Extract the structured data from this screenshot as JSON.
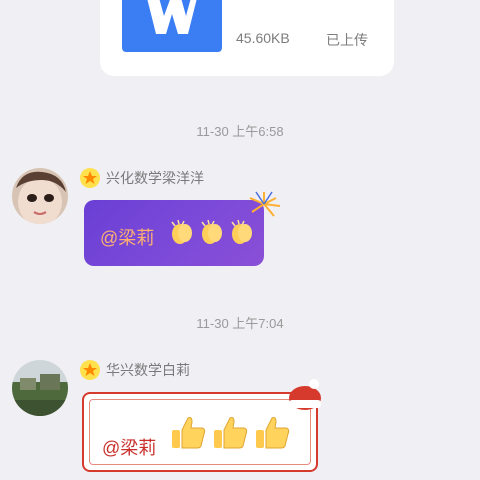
{
  "file_message": {
    "icon": "word-document-icon",
    "size": "45.60KB",
    "status": "已上传"
  },
  "messages": [
    {
      "timestamp": "11-30 上午6:58",
      "sender": "兴化数学梁洋洋",
      "badge_icon": "star-icon",
      "text": "@梁莉",
      "emoji": [
        "clapping-hands-icon",
        "clapping-hands-icon",
        "clapping-hands-icon"
      ],
      "bubble_color": "#7240d6",
      "text_color": "#ffb070"
    },
    {
      "timestamp": "11-30 上午7:04",
      "sender": "华兴数学白莉",
      "badge_icon": "star-icon",
      "text": "@梁莉",
      "emoji": [
        "thumbs-up-icon",
        "thumbs-up-icon",
        "thumbs-up-icon"
      ],
      "bubble_color": "#ffffff",
      "text_color": "#c9302c"
    }
  ]
}
